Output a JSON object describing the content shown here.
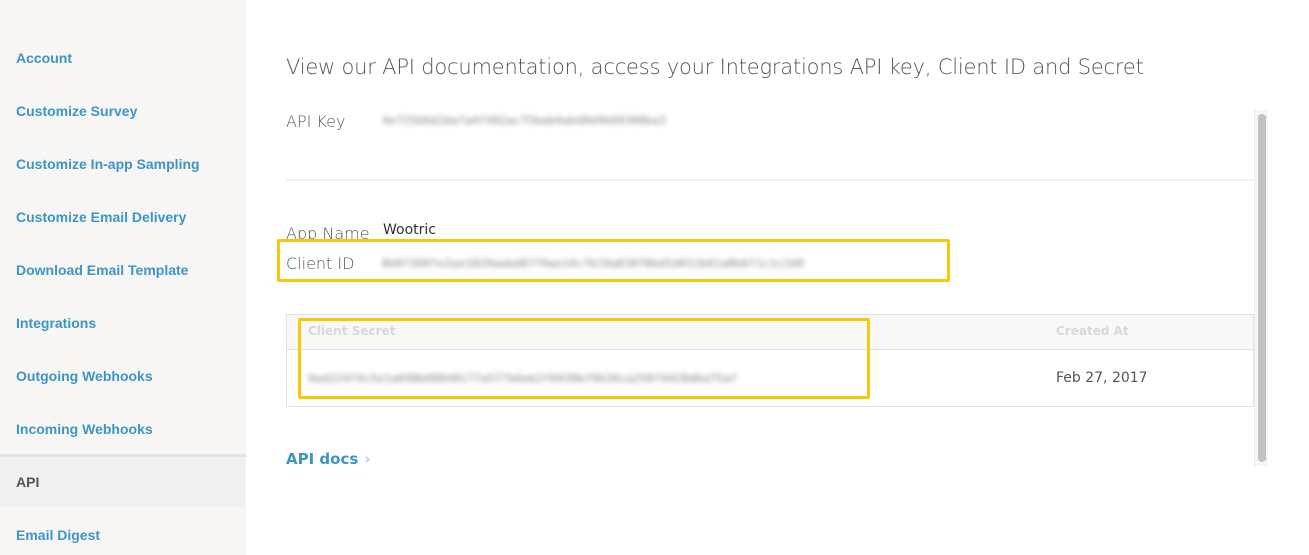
{
  "sidebar": {
    "items": [
      {
        "label": "Account",
        "active": false
      },
      {
        "label": "Customize Survey",
        "active": false
      },
      {
        "label": "Customize In-app Sampling",
        "active": false
      },
      {
        "label": "Customize Email Delivery",
        "active": false
      },
      {
        "label": "Download Email Template",
        "active": false
      },
      {
        "label": "Integrations",
        "active": false
      },
      {
        "label": "Outgoing Webhooks",
        "active": false
      },
      {
        "label": "Incoming Webhooks",
        "active": false
      },
      {
        "label": "API",
        "active": true
      },
      {
        "label": "Email Digest",
        "active": false
      }
    ]
  },
  "main": {
    "title": "View our API documentation, access your Integrations API key, Client ID and Secret",
    "api_key": {
      "label": "API Key",
      "value": "4e725b6d2da7a4f492ac75bab4abd8d4b69308ba3"
    },
    "app_name": {
      "label": "App Name",
      "value": "Wootric"
    },
    "client_id": {
      "label": "Client ID",
      "value": "8b07399fe2ee1029aabd87f9ae14c7b19a830f8bd5d012b61a8b6f1c1c2d9"
    },
    "secrets_table": {
      "columns": [
        "Client Secret",
        "Created At"
      ],
      "rows": [
        {
          "client_secret": "9ad224f4c5e1a698b08840177a577b6eb2f6038bf9b36ca25874428d6a75af",
          "created_at": "Feb 27, 2017"
        }
      ]
    },
    "api_docs_link": {
      "label": "API docs",
      "icon": "chevron-right-icon"
    }
  },
  "colors": {
    "link": "#3d95c6",
    "highlight": "#f8c80a",
    "sidebar_bg": "#f7f6f5"
  }
}
